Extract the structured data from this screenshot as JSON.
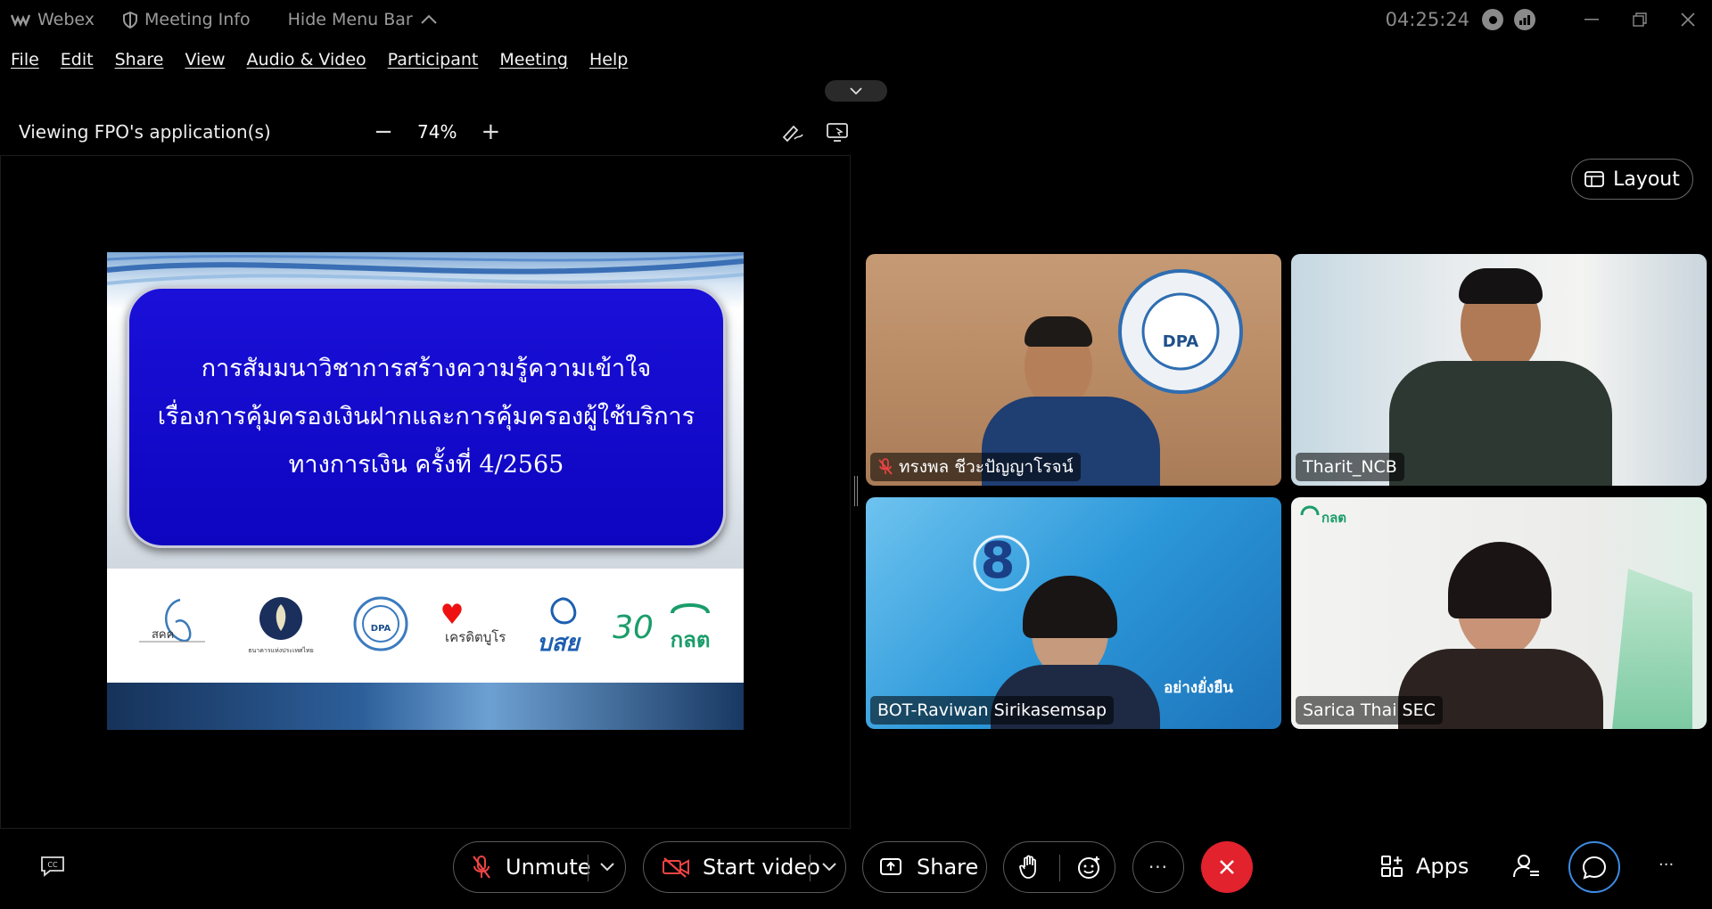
{
  "titlebar": {
    "app_name": "Webex",
    "meeting_info": "Meeting Info",
    "hide_menu": "Hide Menu Bar",
    "time": "04:25:24"
  },
  "menu": {
    "items": [
      "File",
      "Edit",
      "Share",
      "View",
      "Audio & Video",
      "Participant",
      "Meeting",
      "Help"
    ]
  },
  "share": {
    "viewing": "Viewing FPO's application(s)",
    "zoom": "74%",
    "zoom_minus": "−",
    "zoom_plus": "+"
  },
  "slide": {
    "title_lines": [
      "การสัมมนาวิชาการสร้างความรู้ความเข้าใจ",
      "เรื่องการคุ้มครองเงินฝากและการคุ้มครองผู้ใช้บริการ",
      "ทางการเงิน ครั้งที่ 4/2565"
    ],
    "logos": [
      "สคค",
      "ธนาคารแห่งประเทศไทย",
      "DPA",
      "เครดิตบูโร",
      "บสย",
      "30",
      "กลต"
    ]
  },
  "layout_button": "Layout",
  "participants": [
    {
      "name": "ทรงพล ชีวะปัญญาโรจน์",
      "muted": true,
      "backdrop_text": "DPA"
    },
    {
      "name": "Tharit_NCB",
      "muted": false
    },
    {
      "name": "BOT-Raviwan Sirikasemsap",
      "muted": false,
      "backdrop_text": "อย่างยั่งยืน"
    },
    {
      "name": "Sarica Thai SEC",
      "muted": false,
      "backdrop_text": "กลต"
    }
  ],
  "controls": {
    "unmute": "Unmute",
    "start_video": "Start video",
    "share": "Share",
    "apps": "Apps",
    "more": "···"
  },
  "colors": {
    "end_call": "#e2222d",
    "chat_ring": "#3d8be5",
    "slide_box": "#1a10d8"
  }
}
